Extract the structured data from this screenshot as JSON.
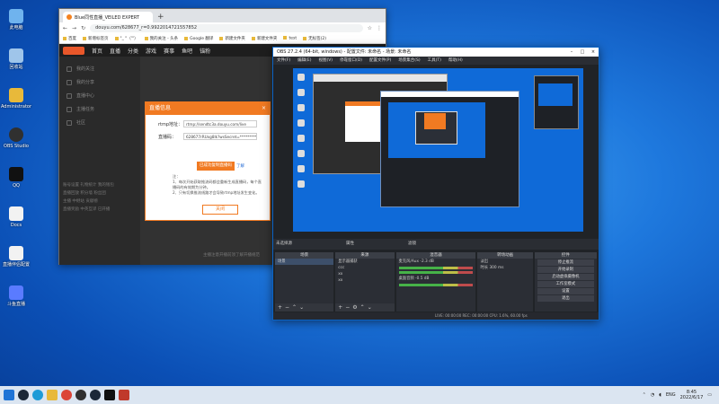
{
  "desktop": {
    "icons": [
      {
        "label": "此电脑",
        "color": "#6fb3ee",
        "icon": "computer-icon"
      },
      {
        "label": "回收站",
        "color": "#9fc5ea",
        "icon": "recycle-bin-icon"
      },
      {
        "label": "Administrator",
        "color": "#e8b93a",
        "icon": "user-folder-icon"
      },
      {
        "label": "OBS Studio",
        "color": "#303030",
        "icon": "obs-icon"
      },
      {
        "label": "QQ",
        "color": "#111111",
        "icon": "qq-icon"
      },
      {
        "label": "Docs",
        "color": "#f2f2f2",
        "icon": "document-icon"
      },
      {
        "label": "直播伴侣配置",
        "color": "#f2f2f2",
        "icon": "file-icon"
      },
      {
        "label": "斗鱼直播",
        "color": "#5a7bff",
        "icon": "discord-icon"
      }
    ]
  },
  "browser": {
    "tab_title": "Blue同性直播_VEILED EXPERT",
    "url": "douyu.com/628677_r=0.9922014721557852",
    "bookmarks": [
      "百度",
      "新增标签页",
      "\"_ \"（\"'）",
      "我的关注 - 头条",
      "Google 翻译",
      "新建文件夹",
      "新建文件夹",
      "test",
      "无标签(2)"
    ],
    "site_nav": [
      "首页",
      "直播",
      "分类",
      "游戏",
      "赛事",
      "鱼吧",
      "锚粉"
    ],
    "side": [
      "我的关注",
      "我的分享",
      "直播中心",
      "主播任务",
      "社区"
    ],
    "grid_rows": [
      "账号设置 礼物统计 我的钱包",
      "直播回放 积分墙 粉丝团",
      "主播 中继站 贡献榜",
      "直播奖励 中英互译 已开播"
    ],
    "hint": "主播注意开播前须了解开播规范"
  },
  "dialog": {
    "title": "直播信息",
    "rtmp_label": "rtmp地址：",
    "rtmp_value": "rtmp://sendtc3a.douyu.com/live",
    "key_label": "直播码：",
    "key_value": "628677rRUxg8lk?wsSecret=****************",
    "btn_copy": "已成功复制直播码",
    "link": "了解",
    "note_title": "注：",
    "note_1": "1、每次开始获取推流码都会重新生成直播码，每个直播码的有效期为分钟。",
    "note_2": "2、只有切换推流线路才会导致rtmp地址发生变化。",
    "close": "关闭"
  },
  "obs": {
    "title": "OBS 27.2.4 (64-bit, windows) - 配置文件: 未命名 - 场景: 未命名",
    "menus": [
      "文件(F)",
      "编辑(E)",
      "视图(V)",
      "停靠窗口(D)",
      "配置文件(P)",
      "场景集合(S)",
      "工具(T)",
      "帮助(H)"
    ],
    "scenebar": [
      "未选择源",
      "属性",
      "滤镜"
    ],
    "docks": {
      "scenes": {
        "header": "场景",
        "items": [
          "场景"
        ]
      },
      "sources": {
        "header": "来源",
        "items": [
          "显示器捕获",
          "ccc",
          "xx",
          "xx"
        ]
      },
      "mixer": {
        "header": "混音器",
        "items": [
          "麦克风/Aux  -2.3 dB",
          "桌面音频  -0.5 dB"
        ]
      },
      "transitions": {
        "header": "转场动画",
        "fade": "淡出",
        "duration_label": "时长",
        "duration": "300 ms"
      },
      "controls": {
        "header": "控件",
        "buttons": [
          "停止推流",
          "开始录制",
          "启动虚拟摄像机",
          "工作室模式",
          "设置",
          "退出"
        ]
      }
    },
    "status": "LIVE: 00:00:00   REC: 00:00:00   CPU: 1.6%, 60.00 fps"
  },
  "taskbar": {
    "icons": [
      {
        "icon": "windows-start-icon",
        "color": "#1f74d6"
      },
      {
        "icon": "steam-icon",
        "color": "#1b2838"
      },
      {
        "icon": "edge-icon",
        "color": "#1e9bd7"
      },
      {
        "icon": "explorer-icon",
        "color": "#e8b93a"
      },
      {
        "icon": "chrome-icon",
        "color": "#db4437"
      },
      {
        "icon": "obs-icon",
        "color": "#303030"
      },
      {
        "icon": "steam-icon",
        "color": "#1b2838"
      },
      {
        "icon": "capcut-icon",
        "color": "#111111"
      },
      {
        "icon": "app-icon",
        "color": "#c0392b"
      }
    ],
    "lang": "ENG",
    "time": "8:45",
    "date": "2022/6/17"
  }
}
